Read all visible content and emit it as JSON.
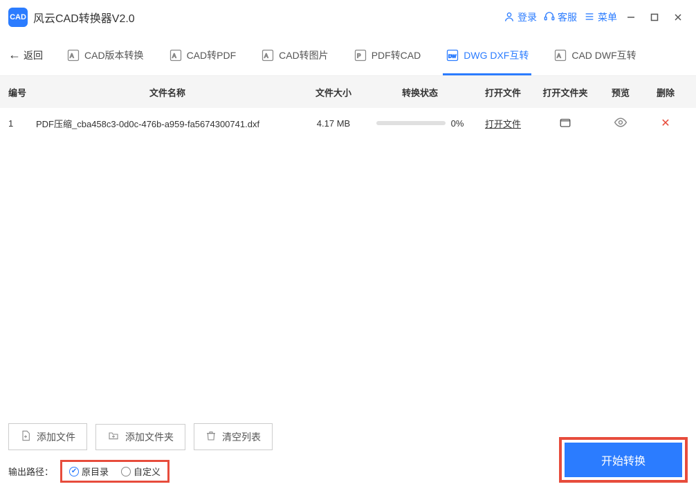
{
  "titlebar": {
    "app_title": "风云CAD转换器V2.0",
    "login": "登录",
    "support": "客服",
    "menu": "菜单"
  },
  "back_label": "返回",
  "tabs": [
    {
      "label": "CAD版本转换"
    },
    {
      "label": "CAD转PDF"
    },
    {
      "label": "CAD转图片"
    },
    {
      "label": "PDF转CAD"
    },
    {
      "label": "DWG DXF互转"
    },
    {
      "label": "CAD DWF互转"
    }
  ],
  "columns": {
    "num": "编号",
    "name": "文件名称",
    "size": "文件大小",
    "status": "转换状态",
    "open": "打开文件",
    "folder": "打开文件夹",
    "preview": "预览",
    "delete": "删除"
  },
  "rows": [
    {
      "num": "1",
      "name": "PDF压缩_cba458c3-0d0c-476b-a959-fa5674300741.dxf",
      "size": "4.17 MB",
      "progress_pct": "0%",
      "open_link": "打开文件"
    }
  ],
  "bottom": {
    "add_file": "添加文件",
    "add_folder": "添加文件夹",
    "clear_list": "清空列表",
    "start": "开始转换",
    "output_label": "输出路径：",
    "radio_original": "原目录",
    "radio_custom": "自定义"
  }
}
